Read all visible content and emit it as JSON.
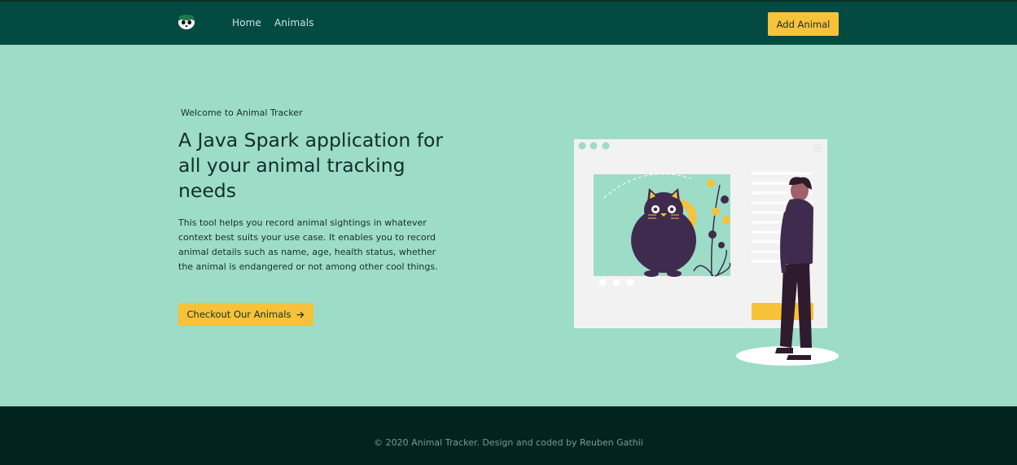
{
  "nav": {
    "logo_icon": "panda-logo-icon",
    "links": [
      {
        "label": "Home"
      },
      {
        "label": "Animals"
      }
    ],
    "add_button": "Add Animal"
  },
  "hero": {
    "eyebrow": "Welcome to Animal Tracker",
    "headline": "A Java Spark application for all your animal tracking needs",
    "description": "This tool helps you record animal sightings in whatever context best suits your use case. It enables you to record animal details such as name, age, health status, whether the animal is endangered or not among other cool things.",
    "cta_label": "Checkout Our Animals",
    "cta_icon": "arrow-right-icon"
  },
  "footer": {
    "copyright": "© 2020 Animal Tracker. Design and coded by Reuben Gathii"
  },
  "colors": {
    "nav_bg": "#034a42",
    "hero_bg": "#9ddcc6",
    "footer_bg": "#022420",
    "accent": "#f6c23a",
    "illustration_purple": "#3f2b4d"
  }
}
